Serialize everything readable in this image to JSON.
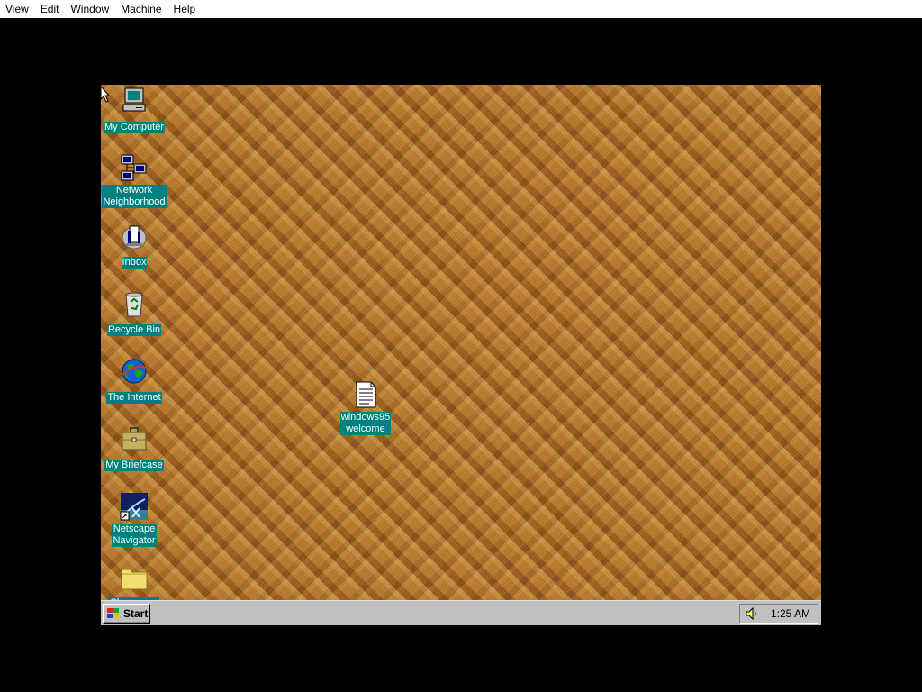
{
  "host_menu": [
    "View",
    "Edit",
    "Window",
    "Machine",
    "Help"
  ],
  "desktop": {
    "icons": [
      {
        "label": "My Computer",
        "icon": "my-computer-icon"
      },
      {
        "label": "Network\nNeighborhood",
        "icon": "network-neighborhood-icon"
      },
      {
        "label": "Inbox",
        "icon": "inbox-icon"
      },
      {
        "label": "Recycle Bin",
        "icon": "recycle-bin-icon"
      },
      {
        "label": "The Internet",
        "icon": "internet-icon"
      },
      {
        "label": "My Briefcase",
        "icon": "briefcase-icon"
      },
      {
        "label": "Netscape\nNavigator",
        "icon": "netscape-icon"
      },
      {
        "label": "Shareware",
        "icon": "folder-icon"
      },
      {
        "label": "windows95\nwelcome",
        "icon": "text-document-icon"
      }
    ]
  },
  "taskbar": {
    "start_label": "Start",
    "clock": "1:25 AM"
  },
  "colors": {
    "label_bg": "#008080",
    "taskbar": "#c0c0c0"
  }
}
